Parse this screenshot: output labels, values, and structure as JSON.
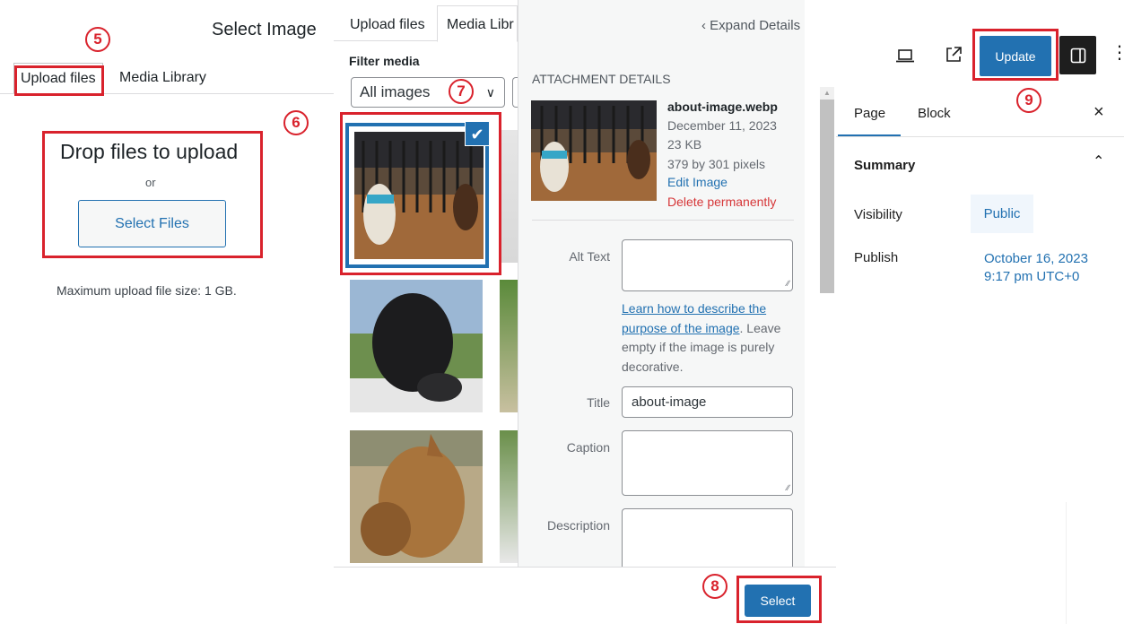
{
  "upload_panel": {
    "title": "Select Image",
    "tabs": [
      "Upload files",
      "Media Library"
    ],
    "drop_title": "Drop files to upload",
    "or_text": "or",
    "select_files_label": "Select Files",
    "max_upload": "Maximum upload file size: 1 GB."
  },
  "media_panel": {
    "tabs": [
      "Upload files",
      "Media Libr"
    ],
    "filter_label": "Filter media",
    "filter_value": "All images",
    "expand_details": "Expand Details",
    "attachment": {
      "heading": "Attachment Details",
      "filename": "about-image.webp",
      "date": "December 11, 2023",
      "size": "23 KB",
      "dimensions": "379 by 301 pixels",
      "edit_link": "Edit Image",
      "delete_link": "Delete permanently"
    },
    "fields": {
      "alt_label": "Alt Text",
      "alt_value": "",
      "help_link": "Learn how to describe the purpose of the image",
      "help_rest": ". Leave empty if the image is purely decorative.",
      "title_label": "Title",
      "title_value": "about-image",
      "caption_label": "Caption",
      "caption_value": "",
      "description_label": "Description",
      "description_value": ""
    },
    "select_button": "Select"
  },
  "editor_panel": {
    "update_button": "Update",
    "tabs": [
      "Page",
      "Block"
    ],
    "close_icon": "×",
    "summary": "Summary",
    "visibility_label": "Visibility",
    "visibility_value": "Public",
    "publish_label": "Publish",
    "publish_value_line1": "October 16, 2023",
    "publish_value_line2": "9:17 pm UTC+0"
  },
  "annotations": {
    "steps": [
      "5",
      "6",
      "7",
      "8",
      "9"
    ],
    "color": "#d9222c"
  },
  "colors": {
    "accent": "#2271b1",
    "danger": "#d63638"
  }
}
